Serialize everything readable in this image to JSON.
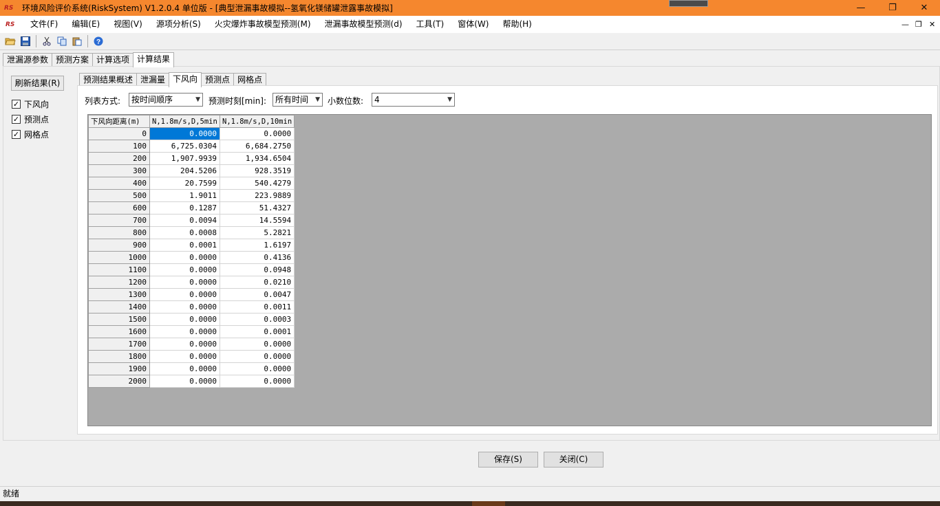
{
  "window": {
    "logo_text": "RS",
    "title": "环境风险评价系统(RiskSystem) V1.2.0.4 单位版 - [典型泄漏事故模拟--氢氧化镁储罐泄露事故模拟]",
    "min_glyph": "—",
    "max_glyph": "❐",
    "close_glyph": "✕"
  },
  "menubar": {
    "items": [
      "文件(F)",
      "编辑(E)",
      "视图(V)",
      "源项分析(S)",
      "火灾爆炸事故模型预测(M)",
      "泄漏事故模型预测(d)",
      "工具(T)",
      "窗体(W)",
      "帮助(H)"
    ],
    "mdi_min": "—",
    "mdi_restore": "❐",
    "mdi_close": "✕"
  },
  "toolbar": {
    "icons": [
      "open-folder-icon",
      "save-icon",
      "cut-icon",
      "copy-icon",
      "paste-icon",
      "help-icon"
    ]
  },
  "outer_tabs": [
    "泄漏源参数",
    "预测方案",
    "计算选项",
    "计算结果"
  ],
  "left_panel": {
    "refresh_label": "刷新结果(R)",
    "checks": [
      {
        "label": "下风向",
        "checked": true
      },
      {
        "label": "预测点",
        "checked": true
      },
      {
        "label": "网格点",
        "checked": true
      }
    ]
  },
  "inner_tabs": [
    "预测结果概述",
    "泄漏量",
    "下风向",
    "预测点",
    "网格点"
  ],
  "controls": {
    "list_mode_label": "列表方式:",
    "list_mode_value": "按时间顺序",
    "time_label": "预测时刻[min]:",
    "time_value": "所有时间",
    "decimals_label": "小数位数:",
    "decimals_value": "4"
  },
  "grid": {
    "headers": [
      "下风向距离(m)",
      "N,1.8m/s,D,5min",
      "N,1.8m/s,D,10min"
    ],
    "rows": [
      [
        "0",
        "0.0000",
        "0.0000"
      ],
      [
        "100",
        "6,725.0304",
        "6,684.2750"
      ],
      [
        "200",
        "1,907.9939",
        "1,934.6504"
      ],
      [
        "300",
        "204.5206",
        "928.3519"
      ],
      [
        "400",
        "20.7599",
        "540.4279"
      ],
      [
        "500",
        "1.9011",
        "223.9889"
      ],
      [
        "600",
        "0.1287",
        "51.4327"
      ],
      [
        "700",
        "0.0094",
        "14.5594"
      ],
      [
        "800",
        "0.0008",
        "5.2821"
      ],
      [
        "900",
        "0.0001",
        "1.6197"
      ],
      [
        "1000",
        "0.0000",
        "0.4136"
      ],
      [
        "1100",
        "0.0000",
        "0.0948"
      ],
      [
        "1200",
        "0.0000",
        "0.0210"
      ],
      [
        "1300",
        "0.0000",
        "0.0047"
      ],
      [
        "1400",
        "0.0000",
        "0.0011"
      ],
      [
        "1500",
        "0.0000",
        "0.0003"
      ],
      [
        "1600",
        "0.0000",
        "0.0001"
      ],
      [
        "1700",
        "0.0000",
        "0.0000"
      ],
      [
        "1800",
        "0.0000",
        "0.0000"
      ],
      [
        "1900",
        "0.0000",
        "0.0000"
      ],
      [
        "2000",
        "0.0000",
        "0.0000"
      ]
    ]
  },
  "buttons": {
    "save": "保存(S)",
    "close": "关闭(C)"
  },
  "status": {
    "text": "就绪"
  },
  "colors": {
    "titlebar": "#f5872e",
    "selection": "#0078d7",
    "grid_bg": "#ababab"
  }
}
